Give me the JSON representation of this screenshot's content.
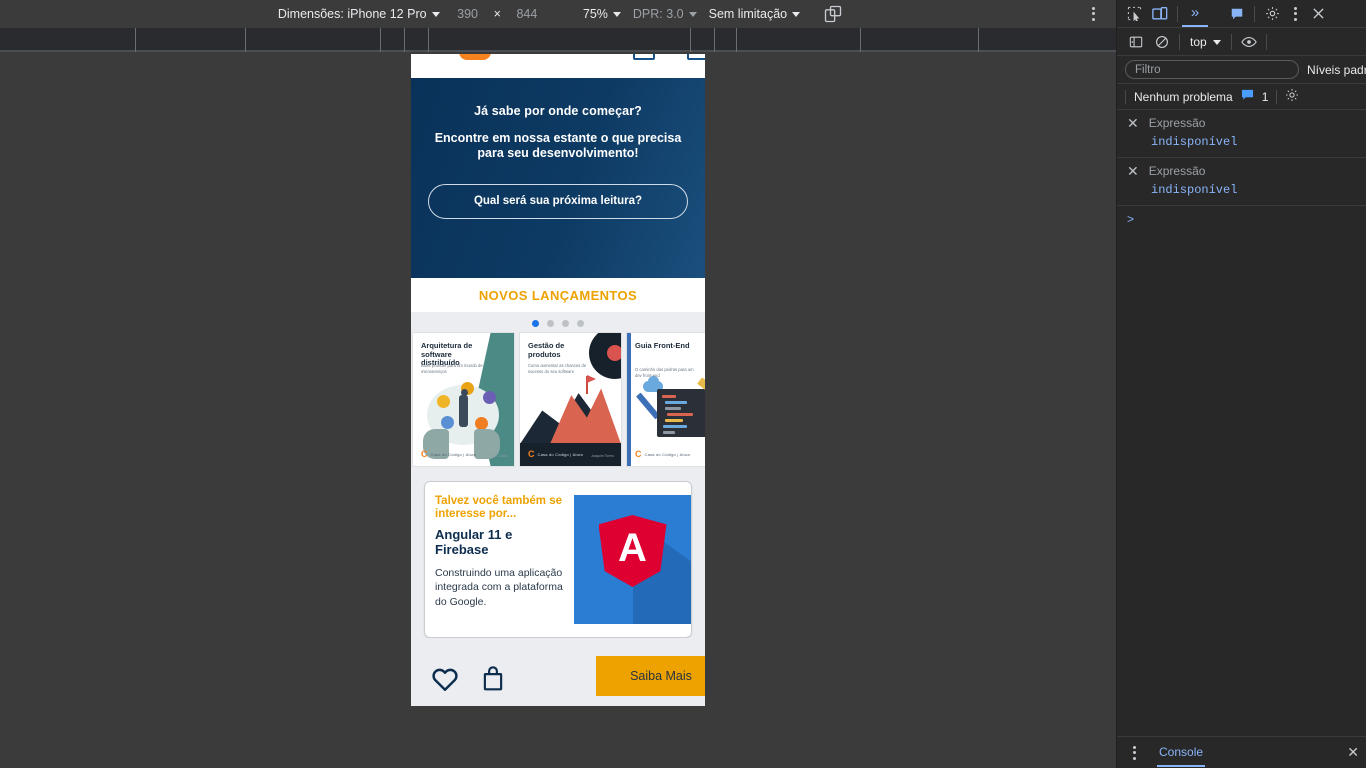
{
  "device_toolbar": {
    "dimensions_label": "Dimensões: iPhone 12 Pro",
    "width": "390",
    "times": "×",
    "height": "844",
    "zoom": "75%",
    "dpr": "DPR: 3.0",
    "throttling": "Sem limitação",
    "rotate_icon": "rotate-icon",
    "more_icon": "more-options-icon"
  },
  "viewport": {
    "hero": {
      "question": "Já sabe por onde começar?",
      "subtitle": "Encontre em nossa estante o que precisa para seu desenvolvimento!",
      "cta": "Qual será sua próxima leitura?"
    },
    "releases": {
      "title": "NOVOS LANÇAMENTOS",
      "dots": 4,
      "active_dot": 0,
      "books": [
        {
          "title": "Arquitetura de software distribuído",
          "subtitle": "Boas práticas para um mundo de microserviços",
          "publisher": "C",
          "brand": "Casa do Código | Alura",
          "author": "Luiz Costa"
        },
        {
          "title": "Gestão de produtos",
          "subtitle": "Como aumentar as chances de sucesso do seu software",
          "publisher": "C",
          "brand": "Casa do Código | Alura",
          "author": "Joaquim Torres"
        },
        {
          "title": "Guia Front-End",
          "subtitle": "O caminho das pedras para um dev front-end",
          "publisher": "C",
          "brand": "Casa do Código | Alura",
          "author": ""
        }
      ]
    },
    "suggestion_card": {
      "kicker": "Talvez você também se interesse por...",
      "title": "Angular 11 e Firebase",
      "description": "Construindo uma aplicação integrada com a plataforma do Google.",
      "media_icon": "angular-logo",
      "media_letter": "A"
    },
    "actions": {
      "favorite_icon": "heart-icon",
      "cart_icon": "shopping-bag-icon",
      "learn_more": "Saiba Mais"
    }
  },
  "devtools": {
    "tabs": {
      "inspect_icon": "inspect-element-icon",
      "device_toggle_icon": "device-toolbar-icon",
      "more_tabs_icon": "more-tabs-chevron-icon",
      "console_tab_icon": "console-panel-icon",
      "settings_icon": "gear-icon",
      "kebab_icon": "more-options-icon",
      "close_icon": "close-icon"
    },
    "console_toolbar": {
      "sidebar_icon": "console-sidebar-icon",
      "clear_icon": "clear-console-icon",
      "context": "top",
      "eye_icon": "live-expression-icon"
    },
    "filter_bar": {
      "filter_placeholder": "Filtro",
      "filter_value": "",
      "levels": "Níveis padrão"
    },
    "issues_bar": {
      "text": "Nenhum problema",
      "badge_icon": "message-icon",
      "count": "1",
      "settings_icon": "gear-icon"
    },
    "live_expressions": [
      {
        "close_icon": "close-icon",
        "label": "Expressão",
        "value": "indisponível"
      },
      {
        "close_icon": "close-icon",
        "label": "Expressão",
        "value": "indisponível"
      }
    ],
    "prompt": ">",
    "drawer": {
      "kebab_icon": "more-options-icon",
      "tab": "Console",
      "close_icon": "close-icon"
    }
  },
  "colors": {
    "accent_orange": "#eda200",
    "brand_orange": "#f6821f",
    "navy": "#0a3259",
    "devtools_bg": "#282828",
    "link_blue": "#8ab4f8",
    "angular_red": "#dd0031",
    "angular_blue": "#2b7cd3"
  }
}
